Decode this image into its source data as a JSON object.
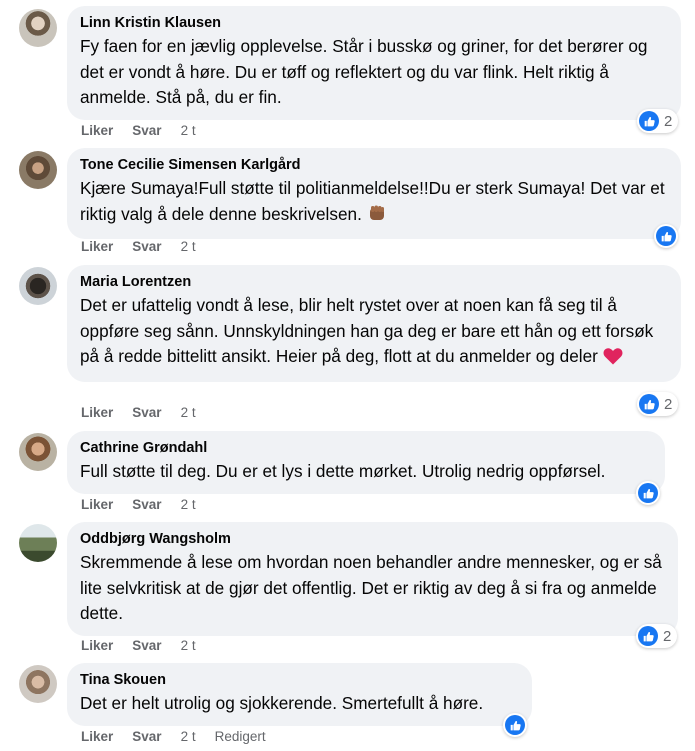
{
  "colors": {
    "bubble": "#f0f2f5",
    "like_blue": "#1877f2",
    "meta_gray": "#65676b",
    "heart_red": "#e0245e"
  },
  "actions": {
    "like": "Liker",
    "reply": "Svar"
  },
  "comments": [
    {
      "author": "Linn Kristin Klausen",
      "text": "Fy faen for en jævlig opplevelse. Står i busskø og griner, for det berører og det er vondt å høre. Du er tøff og reflektert og du var flink. Helt riktig å anmelde. Stå på, du er fin.",
      "time": "2 t",
      "reactions": "2",
      "reaction_icon": "like-icon"
    },
    {
      "author": "Tone Cecilie Simensen Karlgård",
      "text": "Kjære Sumaya!Full støtte til politianmeldelse!!Du er sterk Sumaya! Det var et riktig valg å dele denne beskrivelsen.",
      "emoji": "raised-fist-emoji",
      "time": "2 t",
      "reactions": "",
      "reaction_icon": "like-icon"
    },
    {
      "author": "Maria Lorentzen",
      "text": "Det er ufattelig vondt å lese, blir helt rystet over at noen kan få seg til å oppføre seg sånn. Unnskyldningen han ga deg er bare ett hån og ett forsøk på å redde bittelitt ansikt. Heier på deg, flott at du anmelder og deler",
      "emoji": "red-heart-emoji",
      "time": "2 t",
      "reactions": "2",
      "reaction_icon": "like-icon"
    },
    {
      "author": "Cathrine Grøndahl",
      "text": "Full støtte til deg. Du er et lys i dette mørket. Utrolig nedrig oppførsel.",
      "time": "2 t",
      "reactions": "",
      "reaction_icon": "like-icon"
    },
    {
      "author": "Oddbjørg Wangsholm",
      "text": "Skremmende å lese om hvordan noen behandler andre mennesker, og er så lite selvkritisk at de gjør det offentlig. Det er riktig av deg å si fra og anmelde dette.",
      "time": "2 t",
      "reactions": "2",
      "reaction_icon": "like-icon"
    },
    {
      "author": "Tina Skouen",
      "text": "Det er helt utrolig og sjokkerende. Smertefullt å høre.",
      "time": "2 t",
      "edited": "Redigert",
      "reactions": "",
      "reaction_icon": "like-icon"
    }
  ]
}
